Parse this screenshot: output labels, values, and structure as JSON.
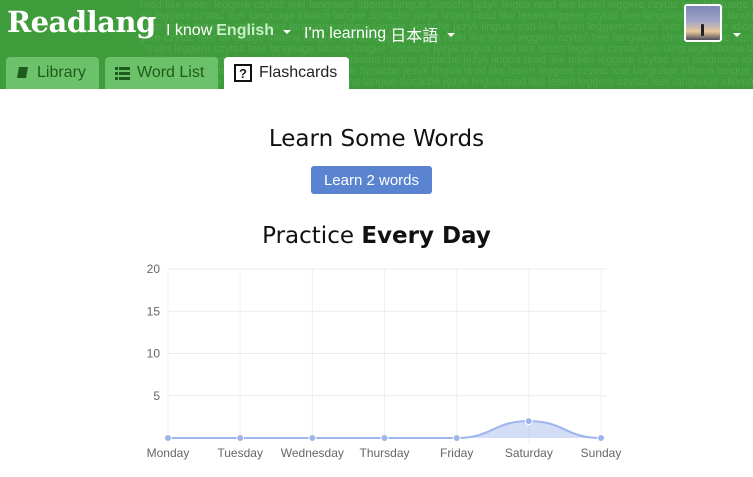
{
  "header": {
    "logo": "Readlang",
    "watermark": "read like lesen leggere czytać leer language idioma langue Sprache język lingua read like lesen leggere czytać leer language idioma langue Sprache język lingua read like lesen leggere",
    "know_prefix": "I know",
    "know_language": "English",
    "learning_prefix": "I'm learning",
    "learning_language": "日本語",
    "background_color": "#3e9c3b"
  },
  "tabs": [
    {
      "label": "Library",
      "icon": "book-icon"
    },
    {
      "label": "Word List",
      "icon": "list-icon"
    },
    {
      "label": "Flashcards",
      "icon": "question-icon",
      "active": true
    }
  ],
  "learn": {
    "heading": "Learn Some Words",
    "button_label": "Learn 2 words",
    "button_color": "#5a83d0"
  },
  "practice": {
    "heading_prefix": "Practice",
    "heading_bold": "Every Day"
  },
  "chart_data": {
    "type": "area",
    "categories": [
      "Monday",
      "Tuesday",
      "Wednesday",
      "Thursday",
      "Friday",
      "Saturday",
      "Sunday"
    ],
    "values": [
      0,
      0,
      0,
      0,
      0,
      2,
      0
    ],
    "ylim": [
      0,
      20
    ],
    "yticks": [
      "20",
      "15",
      "10",
      "5"
    ],
    "grid": true,
    "color": "#9db5ec"
  }
}
